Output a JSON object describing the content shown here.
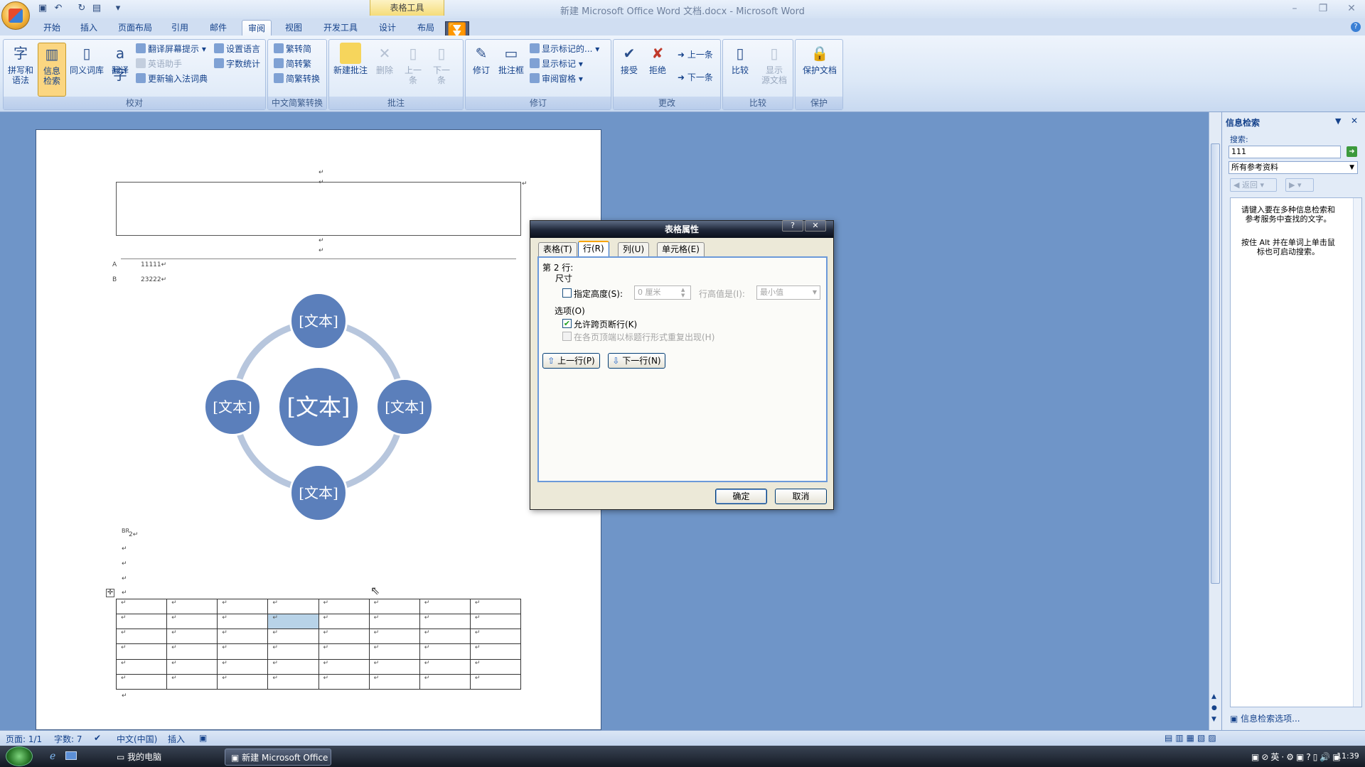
{
  "window": {
    "title": "新建 Microsoft Office Word 文档.docx - Microsoft Word",
    "context_tab_title": "表格工具",
    "controls": [
      "–",
      "❐",
      "✕"
    ]
  },
  "tabs": [
    "开始",
    "插入",
    "页面布局",
    "引用",
    "邮件",
    "审阅",
    "视图",
    "开发工具",
    "设计",
    "布局"
  ],
  "ribbon": {
    "proofing": {
      "label": "校对",
      "spell": "拼写和\n语法",
      "research": "信息\n检索",
      "thesaurus": "同义词库",
      "translate": "翻译",
      "screen_tip": "翻译屏幕提示",
      "eng_assist": "英语助手",
      "set_lang": "设置语言",
      "word_count": "字数统计",
      "update_ime": "更新输入法词典"
    },
    "chinese": {
      "label": "中文简繁转换",
      "t2s": "繁转简",
      "s2t": "简转繁",
      "convert": "简繁转换"
    },
    "comments": {
      "label": "批注",
      "new": "新建批注",
      "delete": "删除",
      "prev": "上一\n条",
      "next": "下一\n条"
    },
    "tracking": {
      "label": "修订",
      "track": "修订",
      "balloons": "批注框",
      "show_markup_final": "显示标记的...",
      "show_markup": "显示标记",
      "review_pane": "审阅窗格"
    },
    "changes": {
      "label": "更改",
      "accept": "接受",
      "reject": "拒绝",
      "prev": "上一条",
      "next": "下一条"
    },
    "compare": {
      "label": "比较",
      "compare": "比较",
      "show_source": "显示\n源文档"
    },
    "protect": {
      "label": "保护",
      "protect_doc": "保护文档"
    }
  },
  "document": {
    "para_mark": "↵",
    "line_a_label": "A",
    "line_a_text": "11111↵",
    "line_b_label": "B",
    "line_b_text": "23222↵",
    "smartart_small": "[文本]",
    "smartart_center": "[文本]",
    "br_text": "BR",
    "br_sub": "2↵"
  },
  "dialog": {
    "title": "表格属性",
    "help": "?",
    "close": "✕",
    "tabs": [
      "表格(T)",
      "行(R)",
      "列(U)",
      "单元格(E)"
    ],
    "row_label": "第 2 行:",
    "size_label": "尺寸",
    "specify_height": "指定高度(S):",
    "height_value": "0 厘米",
    "row_height_is": "行高值是(I):",
    "row_height_mode": "最小值",
    "options_label": "选项(O)",
    "allow_break": "允许跨页断行(K)",
    "repeat_header": "在各页顶端以标题行形式重复出现(H)",
    "prev_row": "上一行(P)",
    "next_row": "下一行(N)",
    "ok": "确定",
    "cancel": "取消"
  },
  "taskpane": {
    "title": "信息检索",
    "search_label": "搜索:",
    "search_value": "111",
    "source": "所有参考资料",
    "back": "返回",
    "hint1": "请键入要在多种信息检索和参考服务中查找的文字。",
    "hint2": "按住 Alt 并在单词上单击鼠标也可启动搜索。",
    "options": "信息检索选项..."
  },
  "statusbar": {
    "page": "页面: 1/1",
    "words": "字数: 7",
    "lang": "中文(中国)",
    "mode": "插入"
  },
  "taskbar": {
    "mycomputer": "我的电脑",
    "word_task": "新建 Microsoft Office ...",
    "ime": "英",
    "time": "11:39"
  }
}
